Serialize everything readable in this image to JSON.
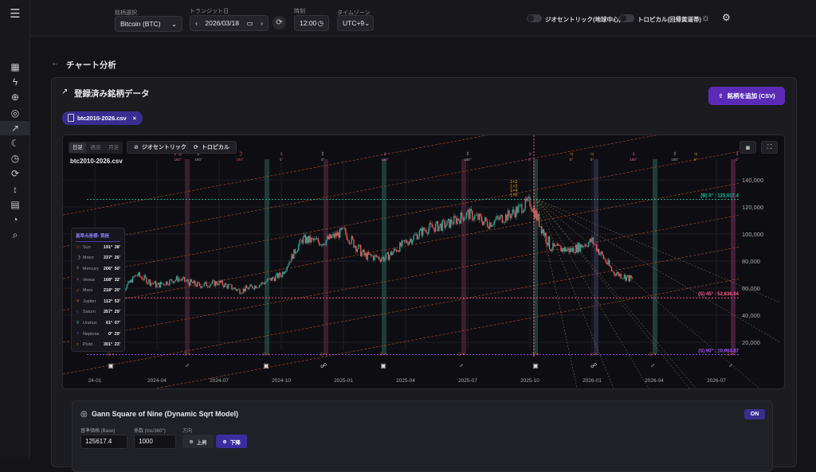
{
  "sidebar": {
    "items": [
      {
        "icon": "grid-icon"
      },
      {
        "icon": "bolt-icon"
      },
      {
        "icon": "crosshair-icon"
      },
      {
        "icon": "target-icon"
      },
      {
        "icon": "trending-up-icon",
        "active": true
      },
      {
        "icon": "moon-icon"
      },
      {
        "icon": "clock-icon"
      },
      {
        "icon": "refresh-icon"
      },
      {
        "icon": "arrows-vertical-icon"
      },
      {
        "icon": "calendar-icon"
      },
      {
        "icon": "gauge-icon"
      },
      {
        "icon": "search-icon"
      }
    ]
  },
  "header": {
    "symbol_label": "銘柄選択",
    "symbol_value": "Bitcoin (BTC)",
    "date_label": "トランジット日",
    "date_value": "2026/03/18",
    "time_label": "時刻",
    "time_value": "12:00",
    "tz_label": "タイムゾーン",
    "tz_value": "UTC+9",
    "geocentric_toggle": "ジオセントリック(地球中心)",
    "geocentric_on": false,
    "tropical_toggle": "トロピカル(回帰黄道帯)",
    "tropical_on": false
  },
  "page": {
    "title": "チャート分析"
  },
  "card": {
    "title": "登録済み銘柄データ",
    "add_button": "銘柄を追加 (CSV)",
    "file_chip": "btc2010-2026.csv",
    "chip_close": "×"
  },
  "chart": {
    "tabs": [
      "日足",
      "週足",
      "月足"
    ],
    "active_tab": "日足",
    "geo_button": "ジオセントリック",
    "tropical_button": "トロピカル",
    "file_name": "btc2010-2026.csv",
    "planet_table": {
      "header": "基準点座標: 黄経",
      "rows": [
        {
          "glyph": "☉",
          "name": "Sun",
          "deg": "191°",
          "min": "38'",
          "color": "#e0502a"
        },
        {
          "glyph": "☽",
          "name": "Moon",
          "deg": "337°",
          "min": "26'",
          "color": "#d0d0d0"
        },
        {
          "glyph": "☿",
          "name": "Mercury",
          "deg": "206°",
          "min": "50'",
          "color": "#a0a0a0"
        },
        {
          "glyph": "♀",
          "name": "Venus",
          "deg": "168°",
          "min": "32'",
          "color": "#e060b0"
        },
        {
          "glyph": "♂",
          "name": "Mars",
          "deg": "218°",
          "min": "20'",
          "color": "#e0502a"
        },
        {
          "glyph": "♃",
          "name": "Jupiter",
          "deg": "112°",
          "min": "53'",
          "color": "#e0a030"
        },
        {
          "glyph": "♄",
          "name": "Saturn",
          "deg": "357°",
          "min": "29'",
          "color": "#6040a0"
        },
        {
          "glyph": "♅",
          "name": "Uranus",
          "deg": "61°",
          "min": "07'",
          "color": "#30c0b0"
        },
        {
          "glyph": "♆",
          "name": "Neptune",
          "deg": "0°",
          "min": "29'",
          "color": "#4060e0"
        },
        {
          "glyph": "♇",
          "name": "Pluto",
          "deg": "301°",
          "min": "23'",
          "color": "#c08030"
        }
      ]
    },
    "top_markers": [
      {
        "date": "2024-05",
        "glyph": "☿♅",
        "label": "180°",
        "color": "#e06080"
      },
      {
        "date": "2024-06",
        "glyph": "☿",
        "label": "180°",
        "color": "#aaaaaa"
      },
      {
        "date": "2024-08",
        "glyph": "☽",
        "label": "180°",
        "color": "#e0502a"
      },
      {
        "date": "2024-10",
        "glyph": "♀",
        "label": "0°",
        "color": "#e060b0"
      },
      {
        "date": "2024-12",
        "glyph": "☿",
        "label": "0°",
        "color": "#aaaaaa"
      },
      {
        "date": "2025-03",
        "glyph": "♀",
        "label": "180°",
        "color": "#e060b0"
      },
      {
        "date": "2025-07",
        "glyph": "☿",
        "label": "180°",
        "color": "#aaaaaa"
      },
      {
        "date": "2025-10",
        "glyph": "♀",
        "label": "0°",
        "color": "#e060b0"
      },
      {
        "date": "2025-12",
        "glyph": "♃",
        "label": "0°",
        "color": "#e0a030"
      },
      {
        "date": "2026-01",
        "glyph": "♃",
        "label": "0°",
        "color": "#e0a030"
      },
      {
        "date": "2026-03",
        "glyph": "♀",
        "label": "180°",
        "color": "#e060b0"
      },
      {
        "date": "2026-05",
        "glyph": "☿",
        "label": "180°",
        "color": "#aaaaaa"
      },
      {
        "date": "2026-06",
        "glyph": "♃",
        "label": "0°",
        "color": "#e0a030"
      },
      {
        "date": "2026-08",
        "glyph": "♀",
        "label": "0°",
        "color": "#e060b0"
      }
    ],
    "peak_labels": [
      "1×2",
      "1×3",
      "1×4",
      "1×8"
    ],
    "levels": [
      {
        "label": "(B) 0° : 125,617.4",
        "value": 125617.4,
        "color": "#20c0a0"
      },
      {
        "label": "(S) 45° : 52,836.04",
        "value": 52836.04,
        "color": "#ff5b8a"
      },
      {
        "label": "(S) 90° : 10,904.87",
        "value": 10904.87,
        "color": "#a050ff"
      }
    ],
    "icon_buttons": [
      "camera-icon",
      "fullscreen-icon"
    ]
  },
  "chart_data": {
    "type": "candlestick",
    "x_ticks": [
      "24-01",
      "2024-04",
      "2024-07",
      "2024-10",
      "2025-01",
      "2025-04",
      "2025-07",
      "2025-10",
      "2026-01",
      "2026-04",
      "2026-07"
    ],
    "y_ticks": [
      20000,
      40000,
      60000,
      80000,
      100000,
      120000,
      140000
    ],
    "ylim": [
      10000,
      148000
    ],
    "xlim": [
      "2023-12",
      "2026-09"
    ],
    "close_monthly": [
      [
        "2024-02",
        52000
      ],
      [
        "2024-03",
        70000
      ],
      [
        "2024-04",
        62000
      ],
      [
        "2024-05",
        67000
      ],
      [
        "2024-06",
        62000
      ],
      [
        "2024-07",
        64000
      ],
      [
        "2024-08",
        58000
      ],
      [
        "2024-09",
        63000
      ],
      [
        "2024-10",
        70000
      ],
      [
        "2024-11",
        96000
      ],
      [
        "2024-12",
        94000
      ],
      [
        "2025-01",
        102000
      ],
      [
        "2025-02",
        84000
      ],
      [
        "2025-03",
        82000
      ],
      [
        "2025-04",
        94000
      ],
      [
        "2025-05",
        104000
      ],
      [
        "2025-06",
        107000
      ],
      [
        "2025-07",
        115000
      ],
      [
        "2025-08",
        108000
      ],
      [
        "2025-09",
        114000
      ],
      [
        "2025-10",
        124000
      ],
      [
        "2025-11",
        90000
      ],
      [
        "2025-12",
        88000
      ],
      [
        "2026-01",
        95000
      ],
      [
        "2026-02",
        72000
      ],
      [
        "2026-03",
        66000
      ]
    ]
  },
  "gann": {
    "title": "Gann Square of Nine (Dynamic Sqrt Model)",
    "on_badge": "ON",
    "base_label": "基準価格 (Base)",
    "base_value": "125617.4",
    "coef_label": "係数 (Inc/360°)",
    "coef_value": "1000",
    "dir_label": "方向",
    "up_button": "上昇",
    "down_button": "下降",
    "active_direction": "下降"
  },
  "colors": {
    "accent": "#5b2bb8",
    "chip": "#3b2d8f",
    "up": "#26a69a",
    "down": "#ef5350"
  }
}
